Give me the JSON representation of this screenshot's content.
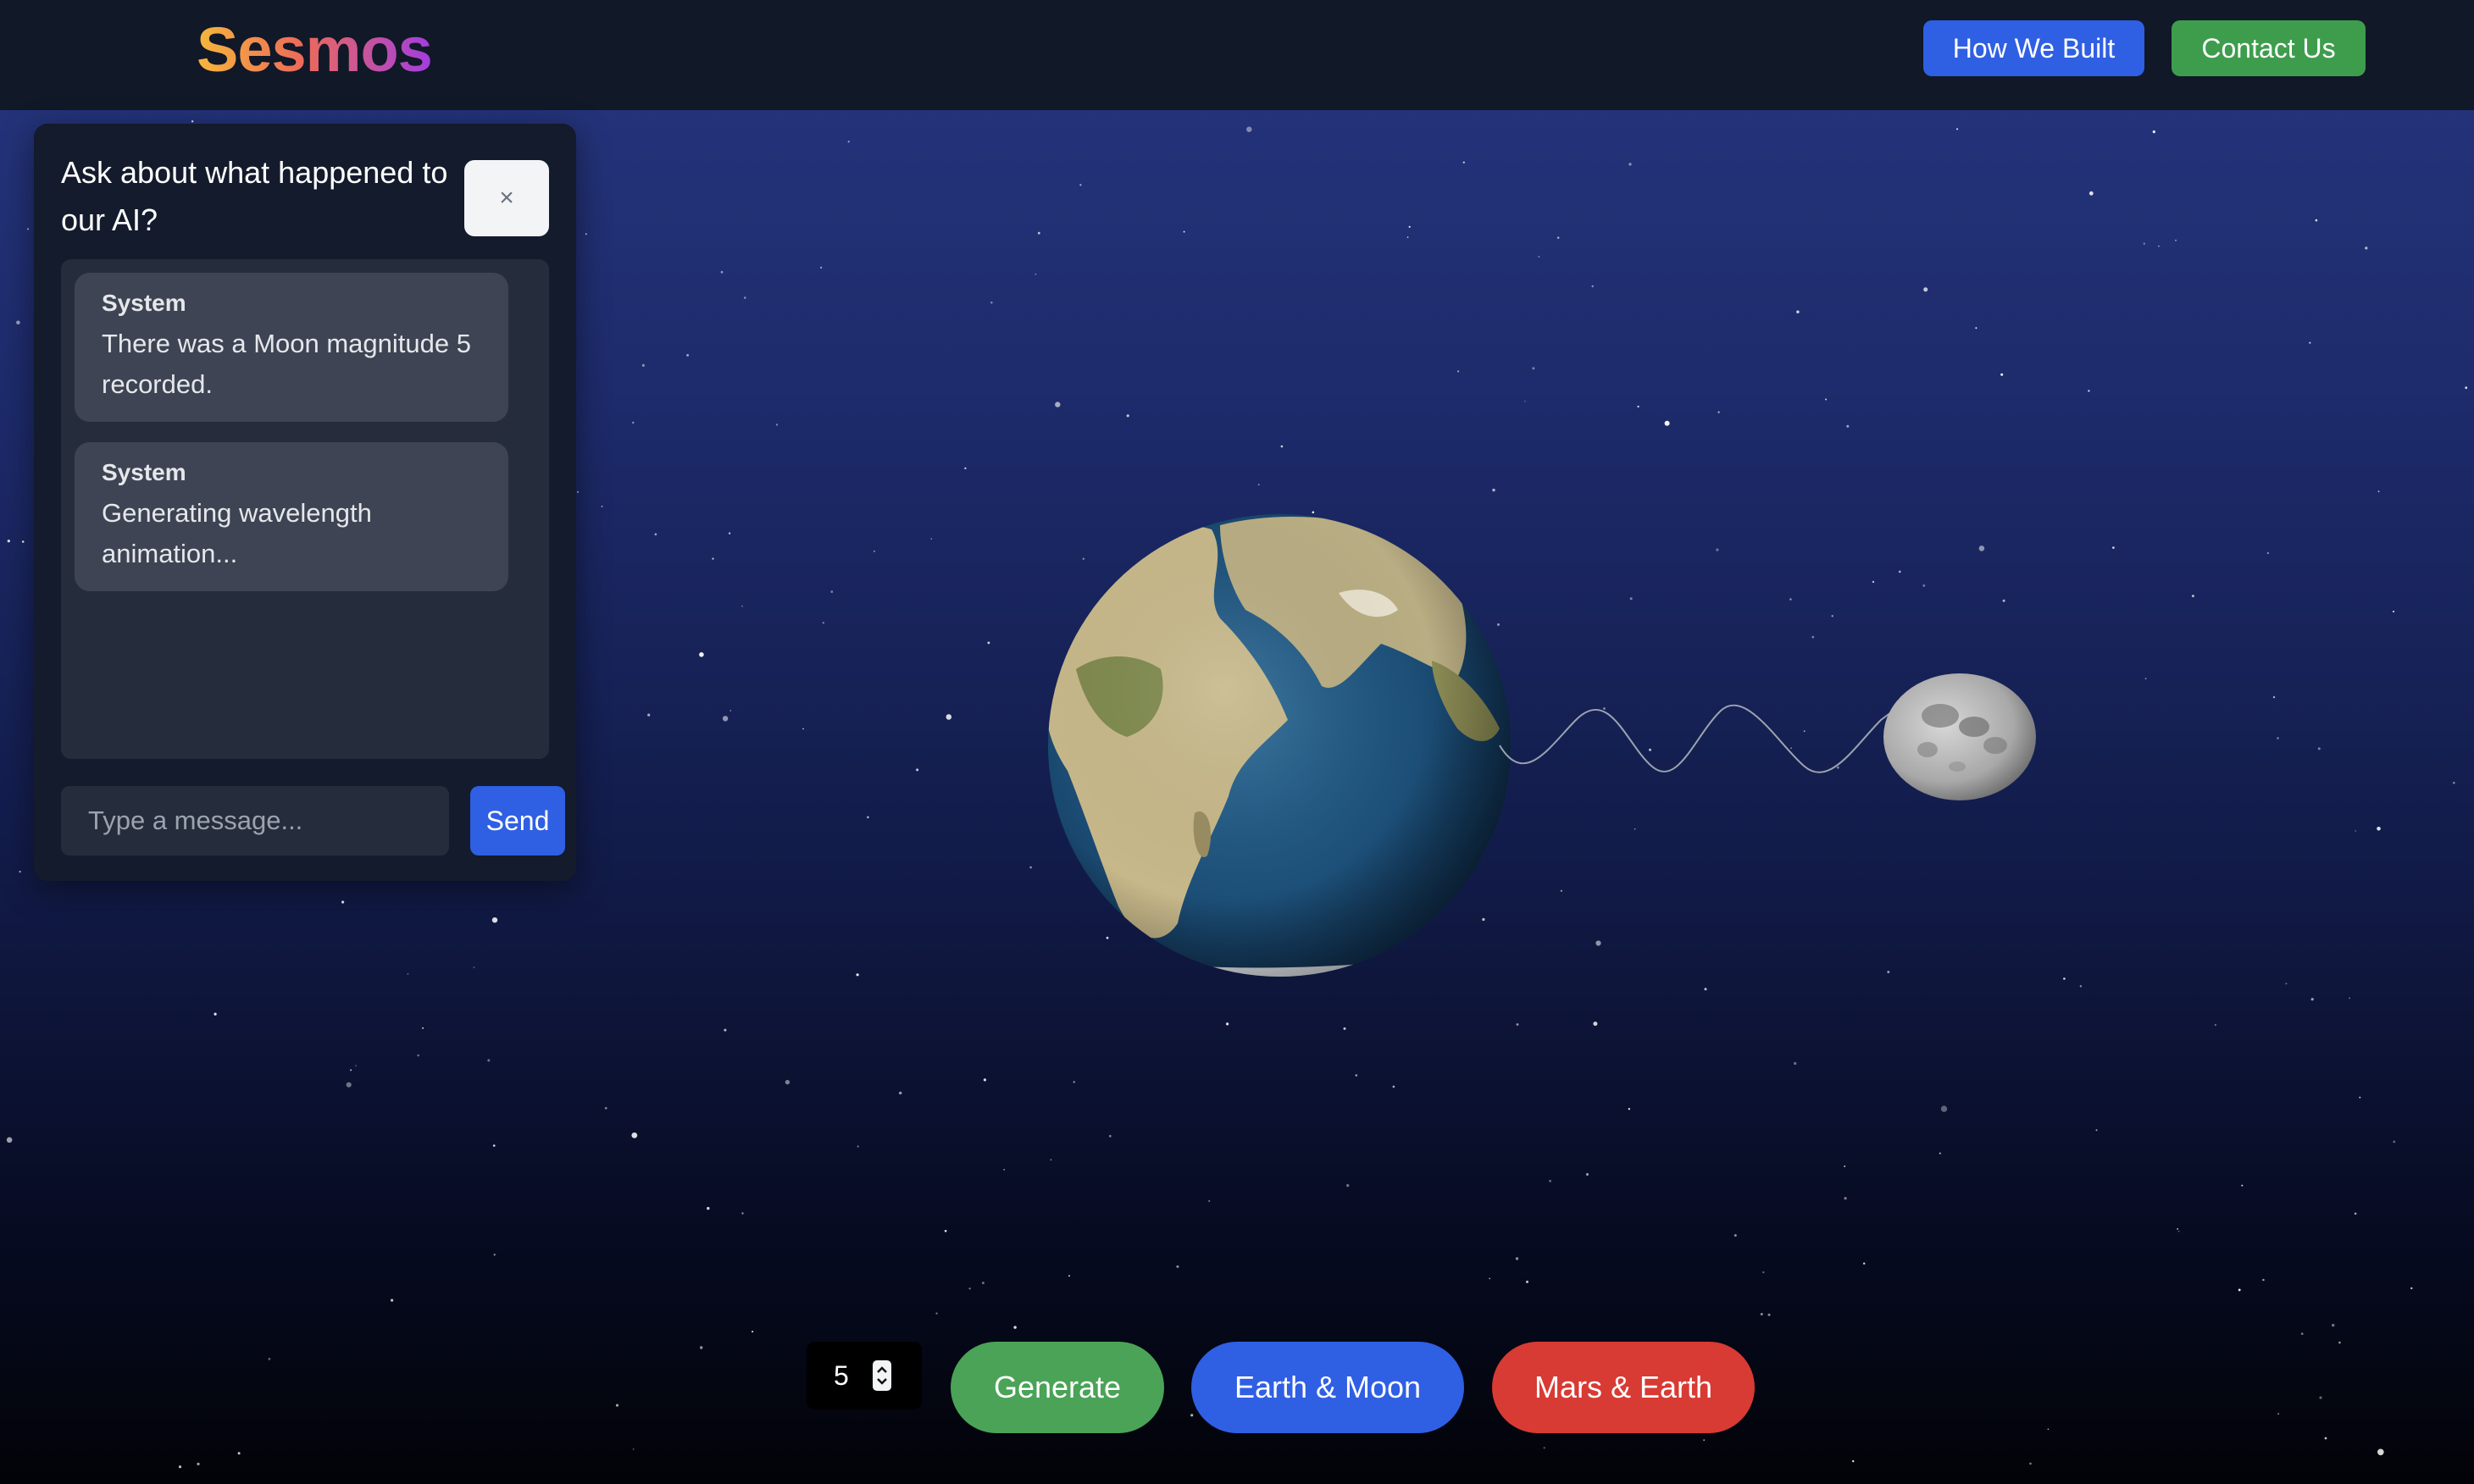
{
  "header": {
    "logo": "Sesmos",
    "how_built_label": "How We Built",
    "contact_label": "Contact Us"
  },
  "chat": {
    "title": "Ask about what happened to our AI?",
    "close_label": "×",
    "messages": [
      {
        "sender": "System",
        "text": "There was a Moon magnitude 5 recorded."
      },
      {
        "sender": "System",
        "text": "Generating wavelength animation..."
      }
    ],
    "input_placeholder": "Type a message...",
    "input_value": "",
    "send_label": "Send"
  },
  "controls": {
    "magnitude_value": "5",
    "generate_label": "Generate",
    "earth_moon_label": "Earth & Moon",
    "mars_earth_label": "Mars & Earth"
  },
  "colors": {
    "primary_blue": "#2f5fe3",
    "green": "#3e9d4d",
    "red": "#d83a34"
  }
}
